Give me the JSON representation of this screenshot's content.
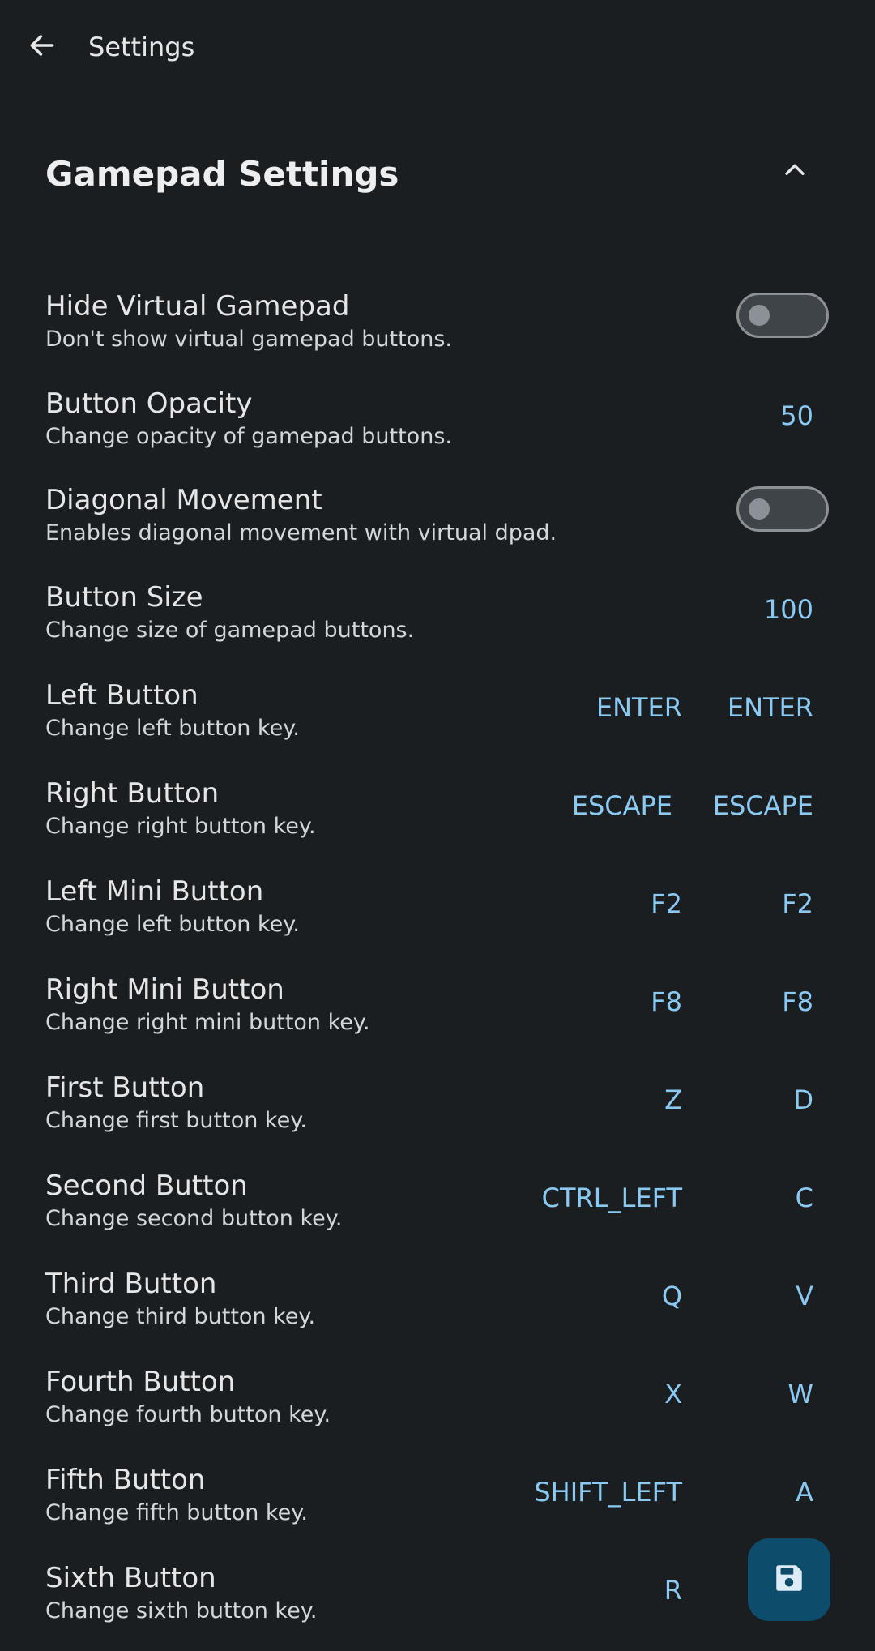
{
  "app_bar": {
    "title": "Settings",
    "back_icon": "arrow-left-icon"
  },
  "section": {
    "title": "Gamepad Settings",
    "collapse_icon": "chevron-up-icon"
  },
  "settings": [
    {
      "title": "Hide Virtual Gamepad",
      "subtitle": "Don't show virtual gamepad buttons.",
      "type": "toggle",
      "checked": false
    },
    {
      "title": "Button Opacity",
      "subtitle": "Change opacity of gamepad buttons.",
      "type": "value",
      "value": "50"
    },
    {
      "title": "Diagonal Movement",
      "subtitle": "Enables diagonal movement with virtual dpad.",
      "type": "toggle",
      "checked": false
    },
    {
      "title": "Button Size",
      "subtitle": "Change size of gamepad buttons.",
      "type": "value",
      "value": "100"
    },
    {
      "title": "Left Button",
      "subtitle": "Change left button key.",
      "type": "keys",
      "key1": "ENTER",
      "key2": "ENTER"
    },
    {
      "title": "Right Button",
      "subtitle": "Change right button key.",
      "type": "keys",
      "key1": "ESCAPE",
      "key2": "ESCAPE"
    },
    {
      "title": "Left Mini Button",
      "subtitle": "Change left button key.",
      "type": "keys",
      "key1": "F2",
      "key2": "F2"
    },
    {
      "title": "Right Mini Button",
      "subtitle": "Change right mini button key.",
      "type": "keys",
      "key1": "F8",
      "key2": "F8"
    },
    {
      "title": "First Button",
      "subtitle": "Change first button key.",
      "type": "keys",
      "key1": "Z",
      "key2": "D"
    },
    {
      "title": "Second Button",
      "subtitle": "Change second button key.",
      "type": "keys",
      "key1": "CTRL_LEFT",
      "key2": "C"
    },
    {
      "title": "Third Button",
      "subtitle": "Change third button key.",
      "type": "keys",
      "key1": "Q",
      "key2": "V"
    },
    {
      "title": "Fourth Button",
      "subtitle": "Change fourth button key.",
      "type": "keys",
      "key1": "X",
      "key2": "W"
    },
    {
      "title": "Fifth Button",
      "subtitle": "Change fifth button key.",
      "type": "keys",
      "key1": "SHIFT_LEFT",
      "key2": "A"
    },
    {
      "title": "Sixth Button",
      "subtitle": "Change sixth button key.",
      "type": "keys",
      "key1": "R",
      "key2": ""
    }
  ],
  "fab": {
    "icon": "save-icon"
  },
  "colors": {
    "background": "#1b1e21",
    "accent_value": "#8ac9f2",
    "fab_background": "#0d4d6b",
    "toggle_off_track": "#3f4449",
    "toggle_off_outline": "#8c9197"
  }
}
